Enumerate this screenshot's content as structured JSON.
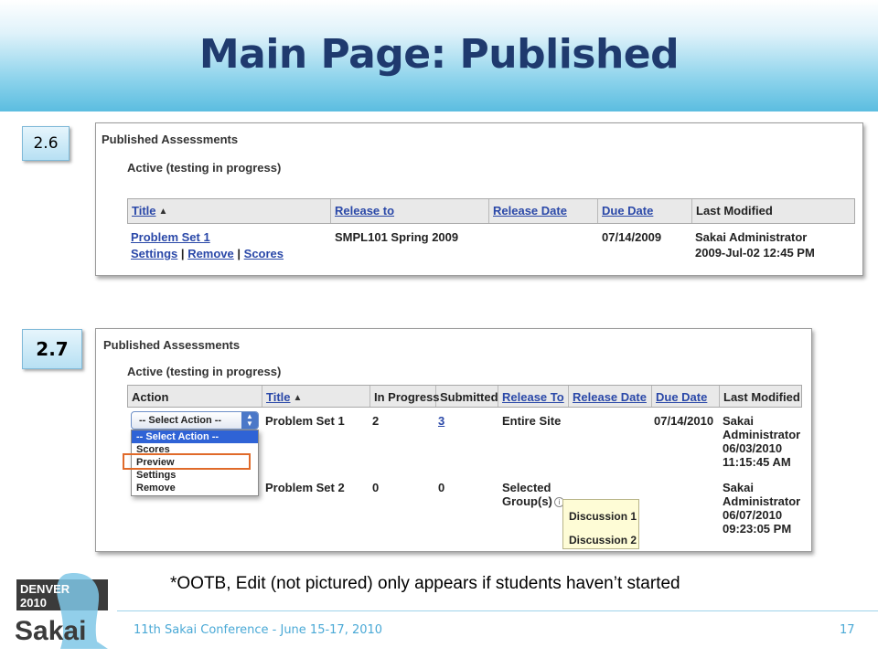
{
  "slide": {
    "title": "Main Page: Published",
    "tag_26": "2.6",
    "tag_27": "2.7",
    "note": "*OOTB, Edit (not pictured) only appears if students haven’t started",
    "footer": "11th Sakai Conference - June 15-17, 2010",
    "page_number": "17",
    "logo": {
      "top_text": "DENVER",
      "year": "2010",
      "name": "Sakai"
    }
  },
  "shot26": {
    "heading": "Published Assessments",
    "subheading": "Active (testing in progress)",
    "columns": [
      "Title",
      "Release to",
      "Release Date",
      "Due Date",
      "Last Modified"
    ],
    "row": {
      "title": "Problem Set 1",
      "actions": [
        "Settings",
        "Remove",
        "Scores"
      ],
      "separator": "|",
      "release_to": "SMPL101 Spring 2009",
      "due_date": "07/14/2009",
      "modified_by": "Sakai Administrator",
      "modified_on": "2009-Jul-02 12:45 PM"
    }
  },
  "shot27": {
    "heading": "Published Assessments",
    "subheading": "Active (testing in progress)",
    "columns": [
      "Action",
      "Title",
      "In Progress",
      "Submitted",
      "Release To",
      "Release Date",
      "Due Date",
      "Last Modified"
    ],
    "select": {
      "value": "-- Select Action --",
      "options": [
        "-- Select Action --",
        "Scores",
        "Preview",
        "Settings",
        "Remove"
      ]
    },
    "rows": [
      {
        "title": "Problem Set 1",
        "in_progress": "2",
        "submitted": "3",
        "release_to": "Entire Site",
        "due_date": "07/14/2010",
        "modified": [
          "Sakai",
          "Administrator",
          "06/03/2010",
          "11:15:45 AM"
        ]
      },
      {
        "title": "Problem Set 2",
        "in_progress": "0",
        "submitted": "0",
        "release_to": [
          "Selected",
          "Group(s)"
        ],
        "due_date": "",
        "modified": [
          "Sakai",
          "Administrator",
          "06/07/2010",
          "09:23:05 PM"
        ]
      }
    ],
    "tooltip_groups": [
      "Discussion 1",
      "Discussion 2"
    ]
  },
  "colors": {
    "title": "#1f3a6e",
    "link": "#2a48a8",
    "highlight_box": "#e06a2a",
    "footer": "#4aa9d6"
  }
}
